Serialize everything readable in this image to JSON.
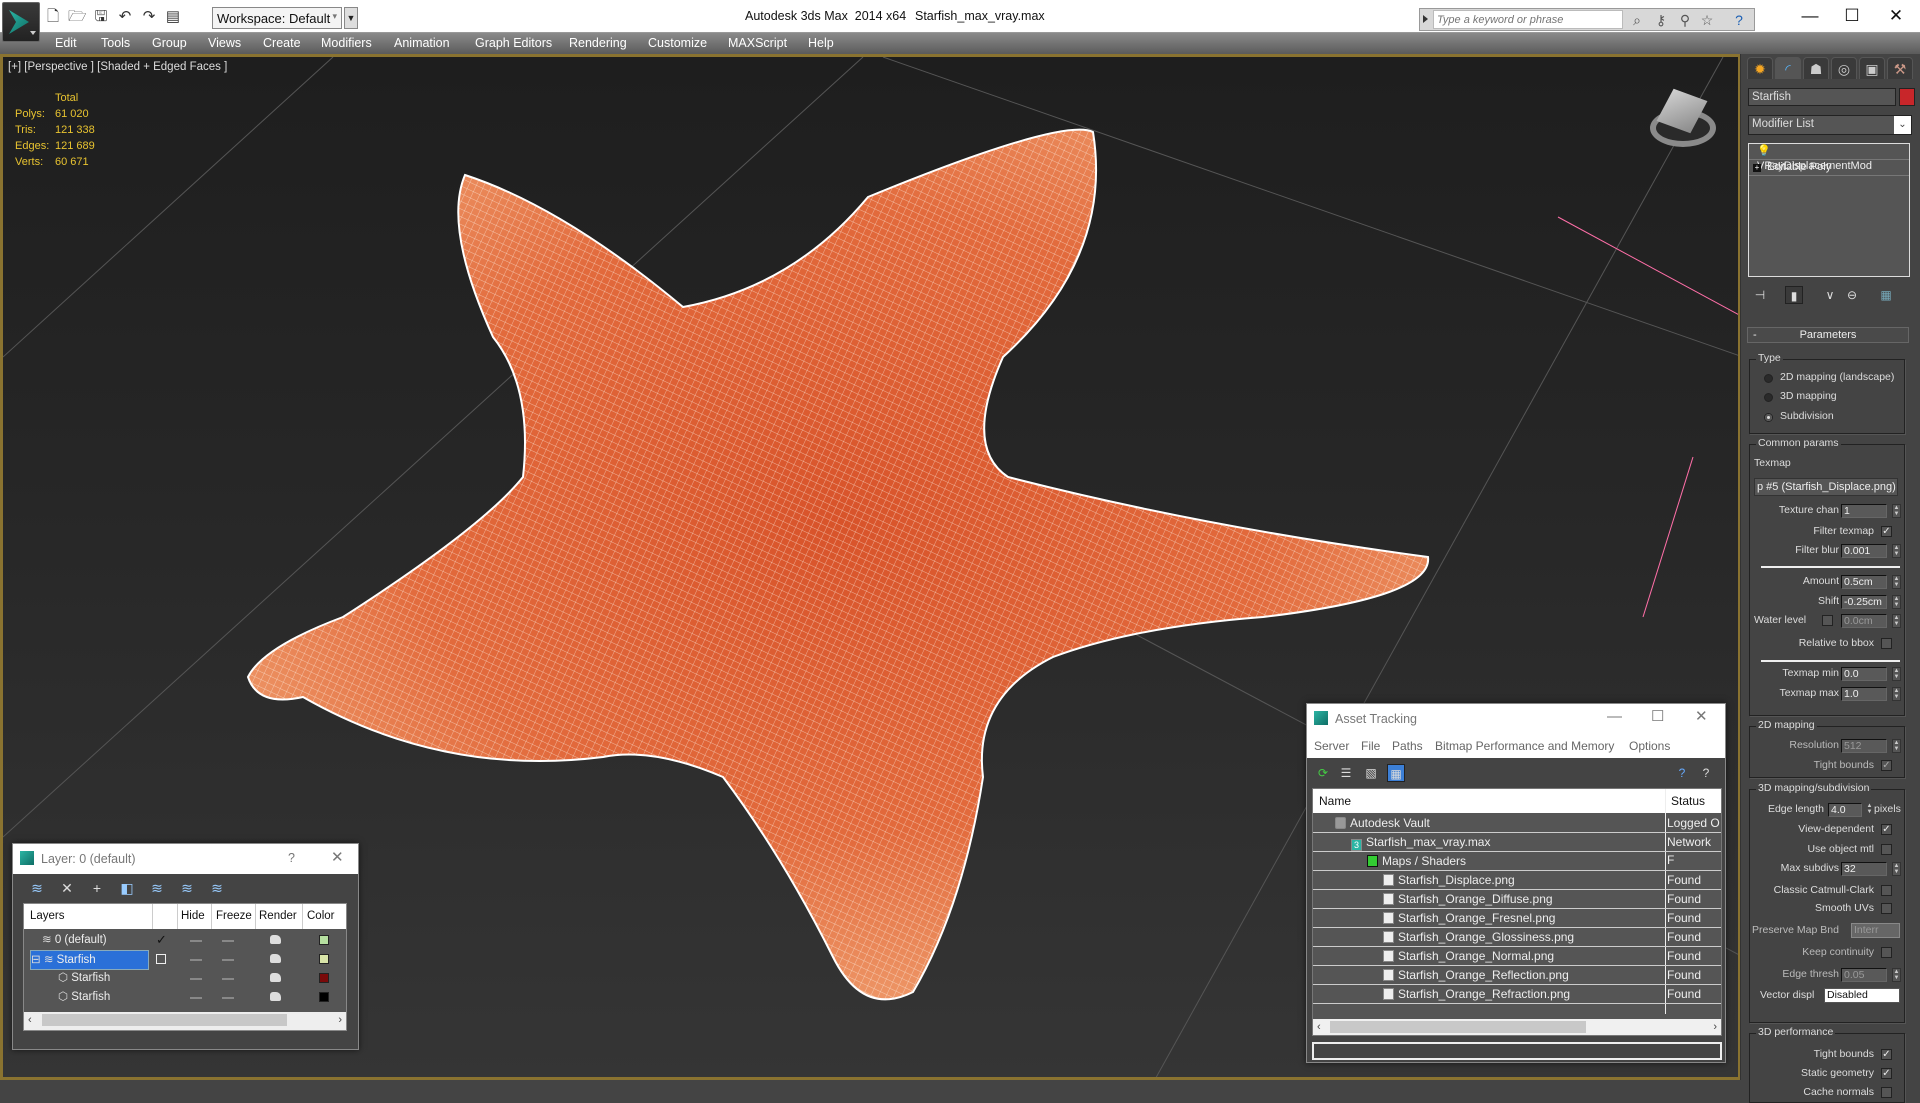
{
  "titlebar": {
    "app_title": "Autodesk 3ds Max  2014 x64",
    "file_name": "Starfish_max_vray.max",
    "workspace": "Workspace: Default",
    "search_placeholder": "Type a keyword or phrase",
    "quick_access_icons": [
      "new-file-icon",
      "open-file-icon",
      "save-icon",
      "undo-icon",
      "redo-icon",
      "project-folder-icon"
    ],
    "search_icons": [
      "binoculars-icon",
      "key-icon",
      "satellite-icon",
      "star-icon",
      "help-icon"
    ]
  },
  "menu": [
    "Edit",
    "Tools",
    "Group",
    "Views",
    "Create",
    "Modifiers",
    "Animation",
    "Graph Editors",
    "Rendering",
    "Customize",
    "MAXScript",
    "Help"
  ],
  "viewport": {
    "label": "[+] [Perspective ] [Shaded + Edged Faces ]",
    "stats": {
      "header": "Total",
      "rows": [
        {
          "key": "Polys:",
          "value": "61 020"
        },
        {
          "key": "Tris:",
          "value": "121 338"
        },
        {
          "key": "Edges:",
          "value": "121 689"
        },
        {
          "key": "Verts:",
          "value": "60 671"
        }
      ]
    },
    "object_color": "#e8744a"
  },
  "command_panel": {
    "tabs": [
      "create-icon",
      "modify-icon",
      "hierarchy-icon",
      "motion-icon",
      "display-icon",
      "utilities-icon"
    ],
    "object_name": "Starfish",
    "object_color": "#c8262a",
    "modifier_list": "Modifier List",
    "stack": [
      "VRayDisplacementMod",
      "Editable Poly"
    ],
    "rollout_title": "Parameters",
    "type_group": "Type",
    "type_options": [
      {
        "label": "2D mapping (landscape)",
        "selected": false
      },
      {
        "label": "3D mapping",
        "selected": false
      },
      {
        "label": "Subdivision",
        "selected": true
      }
    ],
    "common_group": "Common params",
    "texmap_label": "Texmap",
    "texmap_value": "p #5 (Starfish_Displace.png)",
    "texture_chan": {
      "label": "Texture chan",
      "value": "1"
    },
    "filter_texmap": {
      "label": "Filter texmap",
      "checked": true
    },
    "filter_blur": {
      "label": "Filter blur",
      "value": "0.001"
    },
    "amount": {
      "label": "Amount",
      "value": "0.5cm"
    },
    "shift": {
      "label": "Shift",
      "value": "-0.25cm"
    },
    "water_level": {
      "label": "Water level",
      "value": "0.0cm",
      "checked": false
    },
    "relative_bbox": {
      "label": "Relative to bbox",
      "checked": false
    },
    "texmap_min": {
      "label": "Texmap min",
      "value": "0.0"
    },
    "texmap_max": {
      "label": "Texmap max",
      "value": "1.0"
    },
    "mapping2d_group": "2D mapping",
    "resolution": {
      "label": "Resolution",
      "value": "512"
    },
    "tight_bounds_2d": {
      "label": "Tight bounds",
      "checked": true
    },
    "mapping3d_group": "3D mapping/subdivision",
    "edge_length": {
      "label": "Edge length",
      "value": "4.0",
      "unit": "pixels"
    },
    "view_dependent": {
      "label": "View-dependent",
      "checked": true
    },
    "use_object_mtl": {
      "label": "Use object mtl",
      "checked": false
    },
    "max_subdivs": {
      "label": "Max subdivs",
      "value": "32"
    },
    "classic_catmull": {
      "label": "Classic Catmull-Clark",
      "checked": false
    },
    "smooth_uvs": {
      "label": "Smooth UVs",
      "checked": false
    },
    "preserve_map": {
      "label": "Preserve Map Bnd",
      "value": "Interr"
    },
    "keep_continuity": {
      "label": "Keep continuity",
      "checked": false
    },
    "edge_thresh": {
      "label": "Edge thresh",
      "value": "0.05"
    },
    "vector_displ": {
      "label": "Vector displ",
      "value": "Disabled"
    },
    "perf_group": "3D performance",
    "tight_bounds_3d": {
      "label": "Tight bounds",
      "checked": true
    },
    "static_geometry": {
      "label": "Static geometry",
      "checked": true
    },
    "cache_normals": {
      "label": "Cache normals",
      "checked": false
    }
  },
  "asset_tracking": {
    "title": "Asset Tracking",
    "menu": [
      "Server",
      "File",
      "Paths",
      "Bitmap Performance and Memory",
      "Options"
    ],
    "columns": [
      "Name",
      "Status"
    ],
    "rows": [
      {
        "name": "Autodesk Vault",
        "status": "Logged O",
        "level": 0,
        "icon": "vault-icon"
      },
      {
        "name": "Starfish_max_vray.max",
        "status": "Network F",
        "level": 1,
        "icon": "max-file-icon"
      },
      {
        "name": "Maps / Shaders",
        "status": "",
        "level": 2,
        "icon": "maps-icon"
      },
      {
        "name": "Starfish_Displace.png",
        "status": "Found",
        "level": 3,
        "icon": "image-file-icon"
      },
      {
        "name": "Starfish_Orange_Diffuse.png",
        "status": "Found",
        "level": 3,
        "icon": "image-file-icon"
      },
      {
        "name": "Starfish_Orange_Fresnel.png",
        "status": "Found",
        "level": 3,
        "icon": "image-file-icon"
      },
      {
        "name": "Starfish_Orange_Glossiness.png",
        "status": "Found",
        "level": 3,
        "icon": "image-file-icon"
      },
      {
        "name": "Starfish_Orange_Normal.png",
        "status": "Found",
        "level": 3,
        "icon": "image-file-icon"
      },
      {
        "name": "Starfish_Orange_Reflection.png",
        "status": "Found",
        "level": 3,
        "icon": "image-file-icon"
      },
      {
        "name": "Starfish_Orange_Refraction.png",
        "status": "Found",
        "level": 3,
        "icon": "image-file-icon"
      }
    ]
  },
  "layer_dialog": {
    "title": "Layer: 0 (default)",
    "help": "?",
    "columns": [
      "Layers",
      "Hide",
      "Freeze",
      "Render",
      "Color"
    ],
    "rows": [
      {
        "name": "0 (default)",
        "active": true,
        "color": "#b6e0a0",
        "selected": false
      },
      {
        "name": "Starfish",
        "active": false,
        "color": "#d8e4a8",
        "selected": true
      },
      {
        "name": "Starfish",
        "active": false,
        "color": "#7a0a0a",
        "selected": false
      },
      {
        "name": "Starfish",
        "active": false,
        "color": "#000000",
        "selected": false
      }
    ]
  }
}
